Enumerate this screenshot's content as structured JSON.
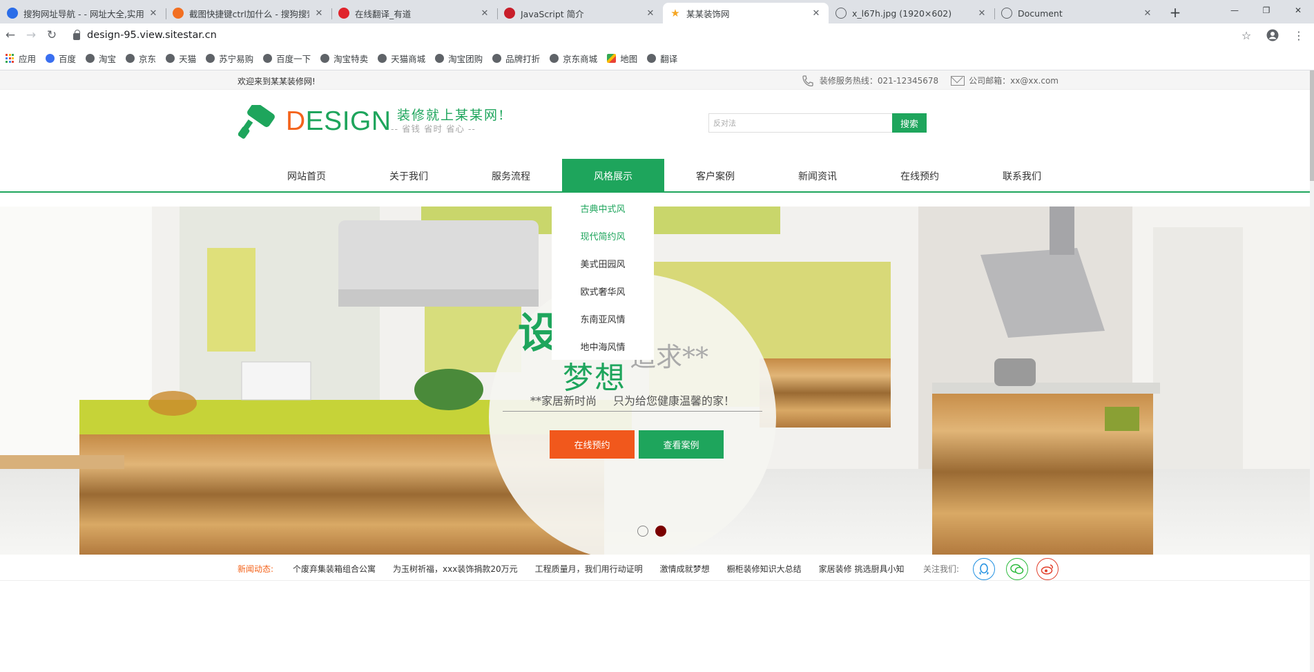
{
  "browser": {
    "tabs": [
      {
        "title": "搜狗网址导航 - - 网址大全,实用",
        "icon": "sogou-nav-icon",
        "color": "#2b6de8",
        "active": false
      },
      {
        "title": "截图快捷键ctrl加什么 - 搜狗搜索",
        "icon": "sogou-search-icon",
        "color": "#f26f21",
        "active": false
      },
      {
        "title": "在线翻译_有道",
        "icon": "youdao-icon",
        "color": "#e0242c",
        "active": false
      },
      {
        "title": "JavaScript 简介",
        "icon": "runoob-icon",
        "color": "#c81e2a",
        "active": false
      },
      {
        "title": "某某装饰网",
        "icon": "star-icon",
        "color": "#f5a623",
        "active": true
      },
      {
        "title": "x_l67h.jpg (1920×602)",
        "icon": "globe-icon",
        "color": "#5f6368",
        "active": false
      },
      {
        "title": "Document",
        "icon": "globe-icon",
        "color": "#5f6368",
        "active": false
      }
    ],
    "url": "design-95.view.sitestar.cn",
    "bookmarks": [
      {
        "label": "应用",
        "icon": "apps-icon"
      },
      {
        "label": "百度",
        "icon": "baidu-paw-icon"
      },
      {
        "label": "淘宝",
        "icon": "globe-icon"
      },
      {
        "label": "京东",
        "icon": "globe-icon"
      },
      {
        "label": "天猫",
        "icon": "globe-icon"
      },
      {
        "label": "苏宁易购",
        "icon": "globe-icon"
      },
      {
        "label": "百度一下",
        "icon": "globe-icon"
      },
      {
        "label": "淘宝特卖",
        "icon": "globe-icon"
      },
      {
        "label": "天猫商城",
        "icon": "globe-icon"
      },
      {
        "label": "淘宝团购",
        "icon": "globe-icon"
      },
      {
        "label": "品牌打折",
        "icon": "globe-icon"
      },
      {
        "label": "京东商城",
        "icon": "globe-icon"
      },
      {
        "label": "地图",
        "icon": "maps-icon"
      },
      {
        "label": "翻译",
        "icon": "globe-icon"
      }
    ]
  },
  "site": {
    "topbar": {
      "welcome": "欢迎来到某某装修网!",
      "hotline": "装修服务热线：021-12345678",
      "email": "公司邮箱：xx@xx.com"
    },
    "logo": {
      "first_letter": "D",
      "rest": "ESIGN"
    },
    "slogan": "装修就上某某网!",
    "slogan_sub": "-- 省钱   省时   省心 --",
    "search": {
      "placeholder": "反对法",
      "button": "搜索"
    },
    "nav": [
      "网站首页",
      "关于我们",
      "服务流程",
      "风格展示",
      "客户案例",
      "新闻资讯",
      "在线预约",
      "联系我们"
    ],
    "nav_active_index": 3,
    "dropdown": [
      "古典中式风",
      "现代简约风",
      "美式田园风",
      "欧式奢华风",
      "东南亚风情",
      "地中海风情"
    ],
    "hero": {
      "title_1": "设计",
      "title_2": "追求**",
      "title_3": "梦想",
      "sub_left": "**家居新时尚",
      "sub_right": "只为给您健康温馨的家！",
      "btn_booking": "在线预约",
      "btn_cases": "查看案例",
      "slide_count": 2,
      "active_slide": 2
    },
    "news": {
      "label": "新闻动态:",
      "items": [
        "个废弃集装箱组合公寓",
        "为玉树祈福，xxx装饰捐款20万元",
        "工程质量月，我们用行动证明",
        "激情成就梦想",
        "橱柜装修知识大总结",
        "家居装修 挑选厨具小知"
      ],
      "follow_label": "关注我们:"
    },
    "colors": {
      "brand_green": "#1ea55c",
      "accent_orange": "#f4631b"
    }
  }
}
